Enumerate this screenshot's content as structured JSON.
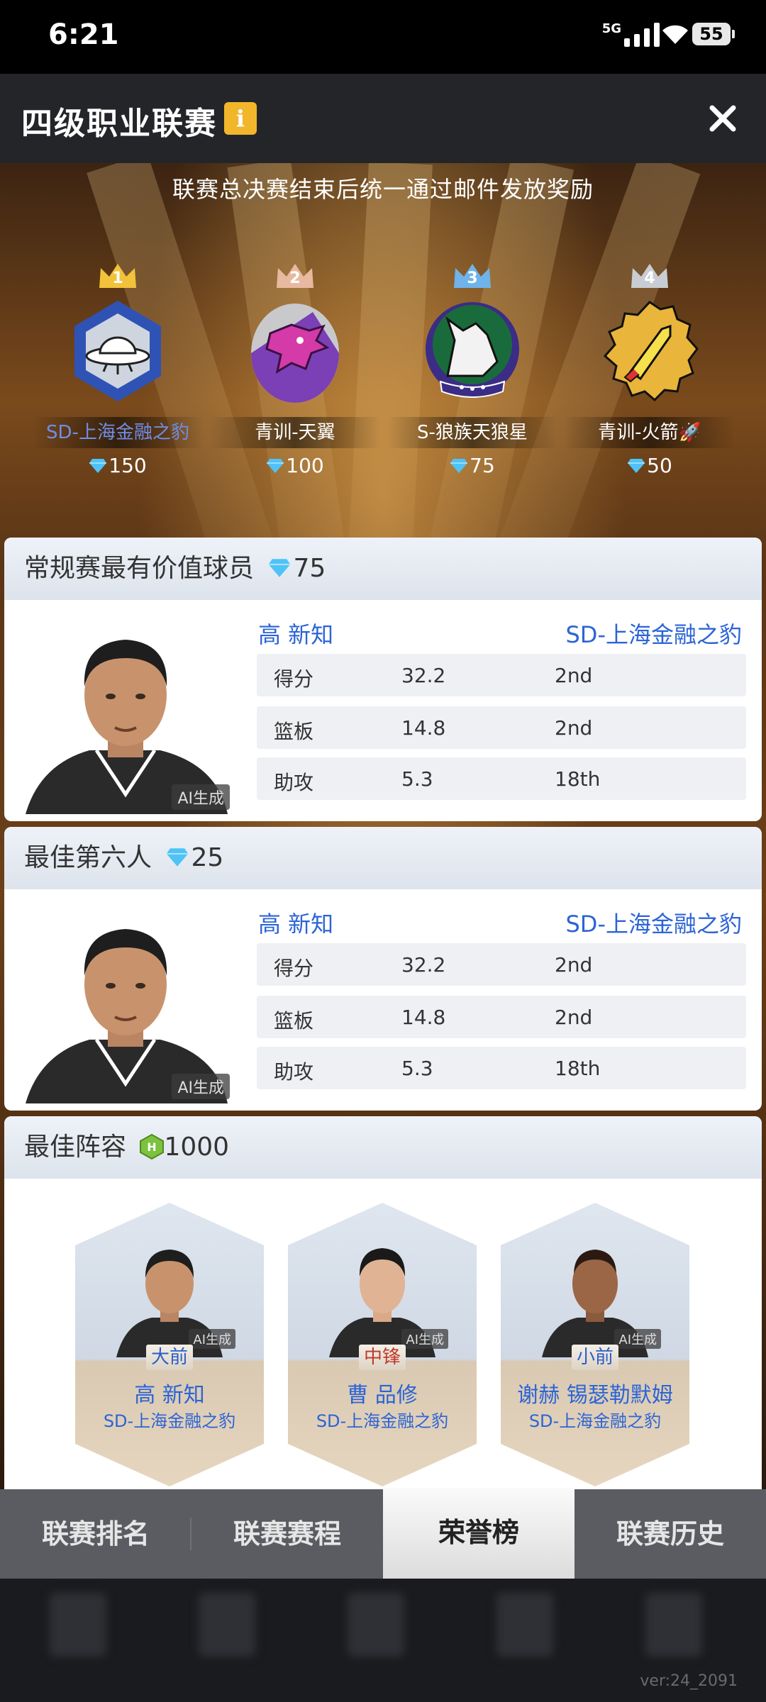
{
  "status": {
    "time": "6:21",
    "network": "5G",
    "battery": "55"
  },
  "header": {
    "title": "四级职业联赛",
    "info_icon": "i"
  },
  "notice": "联赛总决赛结束后统一通过邮件发放奖励",
  "podium": [
    {
      "rank": "1",
      "team": "SD-上海金融之豹",
      "reward": "150",
      "crown_color": "#f2c23a"
    },
    {
      "rank": "2",
      "team": "青训-天翼",
      "reward": "100",
      "crown_color": "#e8b9a0"
    },
    {
      "rank": "3",
      "team": "S-狼族天狼星",
      "reward": "75",
      "crown_color": "#6fb3ea"
    },
    {
      "rank": "4",
      "team": "青训-火箭🚀",
      "reward": "50",
      "crown_color": "#c9cdd3"
    }
  ],
  "mvp": {
    "title": "常规赛最有价值球员",
    "reward": "75",
    "ai_tag": "AI生成",
    "player": "高 新知",
    "team": "SD-上海金融之豹",
    "stats": [
      {
        "label": "得分",
        "value": "32.2",
        "rank": "2nd"
      },
      {
        "label": "篮板",
        "value": "14.8",
        "rank": "2nd"
      },
      {
        "label": "助攻",
        "value": "5.3",
        "rank": "18th"
      }
    ]
  },
  "sixth": {
    "title": "最佳第六人",
    "reward": "25",
    "ai_tag": "AI生成",
    "player": "高 新知",
    "team": "SD-上海金融之豹",
    "stats": [
      {
        "label": "得分",
        "value": "32.2",
        "rank": "2nd"
      },
      {
        "label": "篮板",
        "value": "14.8",
        "rank": "2nd"
      },
      {
        "label": "助攻",
        "value": "5.3",
        "rank": "18th"
      }
    ]
  },
  "lineup": {
    "title": "最佳阵容",
    "reward": "1000",
    "players": [
      {
        "position": "大前",
        "position_color": "#2a5ec9",
        "name": "高 新知",
        "team": "SD-上海金融之豹",
        "ai_tag": "AI生成"
      },
      {
        "position": "中锋",
        "position_color": "#c0392b",
        "name": "曹 品修",
        "team": "SD-上海金融之豹",
        "ai_tag": "AI生成"
      },
      {
        "position": "小前",
        "position_color": "#2a5ec9",
        "name": "谢赫 锡瑟勒默姆",
        "team": "SD-上海金融之豹",
        "ai_tag": "AI生成"
      }
    ]
  },
  "tabs": [
    {
      "label": "联赛排名",
      "active": false
    },
    {
      "label": "联赛赛程",
      "active": false
    },
    {
      "label": "荣誉榜",
      "active": true
    },
    {
      "label": "联赛历史",
      "active": false
    }
  ],
  "version": "ver:24_2091"
}
